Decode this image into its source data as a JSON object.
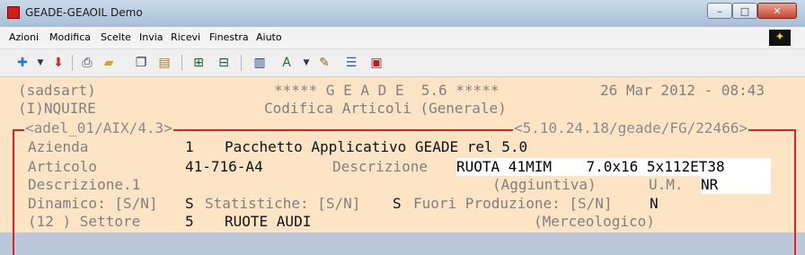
{
  "window": {
    "title": "GEADE-GEAOIL Demo",
    "controls": {
      "min": "–",
      "max": "□",
      "close": "✕"
    }
  },
  "menubar": {
    "items": [
      "Azioni",
      "Modifica",
      "Scelte",
      "Invia",
      "Ricevi",
      "Finestra",
      "Aiuto"
    ],
    "logo": "✦"
  },
  "toolbar": {
    "icons": [
      "new-icon",
      "dropdown-arrow-icon",
      "save-icon",
      "print-icon",
      "open-folder-icon",
      "copy-icon",
      "paste-icon",
      "network-icon",
      "network-alt-icon",
      "book-icon",
      "text-style-icon",
      "dropdown-arrow-icon",
      "edit-icon",
      "notes-icon",
      "window-icon"
    ]
  },
  "terminal": {
    "header": {
      "user": "(sadsart)",
      "product": "***** G E A D E  5.6 *****",
      "datetime": "26 Mar 2012 - 08:43",
      "mode": "(I)NQUIRE",
      "screen_title": "Codifica Articoli (Generale)"
    },
    "frame": {
      "left_label": "<adel_01/AIX/4.3>",
      "right_label": "<5.10.24.18/geade/FG/22466>"
    },
    "fields": {
      "azienda_label": "Azienda",
      "azienda_code": "1",
      "azienda_name": "Pacchetto Applicativo GEADE rel 5.0",
      "articolo_label": "Articolo",
      "articolo_value": "41-716-A4",
      "descrizione_label": "Descrizione",
      "descrizione_value": "RUOTA 41MIM    7.0x16 5x112ET38",
      "descrizione1_label": "Descrizione.1",
      "aggiuntiva_label": "(Aggiuntiva)",
      "um_label": "U.M.",
      "um_value": "NR",
      "dinamico_label": "Dinamico: [S/N]",
      "dinamico_value": "S",
      "statistiche_label": "Statistiche: [S/N]",
      "statistiche_value": "S",
      "fuori_label": "Fuori Produzione: [S/N]",
      "fuori_value": "N",
      "settore_prefix": "(12 ) Settore",
      "settore_code": "5",
      "settore_name": "RUOTE AUDI",
      "merceologico_label": "(Merceologico)"
    }
  }
}
